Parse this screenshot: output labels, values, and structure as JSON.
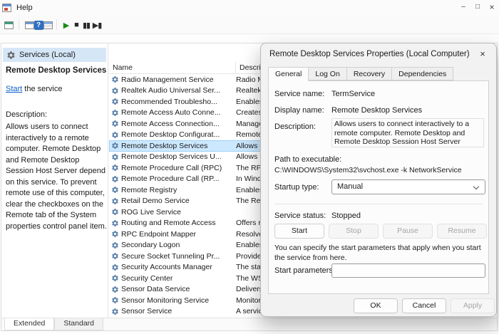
{
  "window": {
    "menu_help": "Help",
    "controls": {
      "minimize": "–",
      "maximize": "□",
      "close": "×"
    }
  },
  "toolbar": {
    "help_glyph": "?",
    "play_glyph": "▶",
    "stop_glyph": "■",
    "pause_glyph": "▮▮",
    "restart_glyph": "▶▮"
  },
  "tree": {
    "root_label": "Services (Local)"
  },
  "left_panel": {
    "title": "Remote Desktop Services",
    "action_link": "Start",
    "action_suffix": " the service",
    "description_heading": "Description:",
    "description": "Allows users to connect interactively to a remote computer. Remote Desktop and Remote Desktop Session Host Server depend on this service. To prevent remote use of this computer, clear the checkboxes on the Remote tab of the System properties control panel item."
  },
  "services_list": {
    "columns": [
      "Name",
      "Description"
    ],
    "selected_index": 6,
    "rows": [
      {
        "name": "Radio Management Service",
        "desc": "Radio M..."
      },
      {
        "name": "Realtek Audio Universal Ser...",
        "desc": "Realtek ..."
      },
      {
        "name": "Recommended Troublesho...",
        "desc": "Enables..."
      },
      {
        "name": "Remote Access Auto Conne...",
        "desc": "Creates ..."
      },
      {
        "name": "Remote Access Connection...",
        "desc": "Manage..."
      },
      {
        "name": "Remote Desktop Configurat...",
        "desc": "Remote ..."
      },
      {
        "name": "Remote Desktop Services",
        "desc": "Allows u..."
      },
      {
        "name": "Remote Desktop Services U...",
        "desc": "Allows u..."
      },
      {
        "name": "Remote Procedure Call (RPC)",
        "desc": "The RPC..."
      },
      {
        "name": "Remote Procedure Call (RP...",
        "desc": "In Wind..."
      },
      {
        "name": "Remote Registry",
        "desc": "Enables..."
      },
      {
        "name": "Retail Demo Service",
        "desc": "The Reta..."
      },
      {
        "name": "ROG Live Service",
        "desc": ""
      },
      {
        "name": "Routing and Remote Access",
        "desc": "Offers ro..."
      },
      {
        "name": "RPC Endpoint Mapper",
        "desc": "Resolves..."
      },
      {
        "name": "Secondary Logon",
        "desc": "Enables..."
      },
      {
        "name": "Secure Socket Tunneling Pr...",
        "desc": "Provides..."
      },
      {
        "name": "Security Accounts Manager",
        "desc": "The start..."
      },
      {
        "name": "Security Center",
        "desc": "The WSC..."
      },
      {
        "name": "Sensor Data Service",
        "desc": "Delivers ..."
      },
      {
        "name": "Sensor Monitoring Service",
        "desc": "Monitor..."
      },
      {
        "name": "Sensor Service",
        "desc": "A service..."
      }
    ]
  },
  "view_tabs": {
    "extended": "Extended",
    "standard": "Standard"
  },
  "dialog": {
    "title": "Remote Desktop Services Properties (Local Computer)",
    "close_glyph": "×",
    "tabs": [
      "General",
      "Log On",
      "Recovery",
      "Dependencies"
    ],
    "general": {
      "service_name_label": "Service name:",
      "service_name": "TermService",
      "display_name_label": "Display name:",
      "display_name": "Remote Desktop Services",
      "description_label": "Description:",
      "description": "Allows users to connect interactively to a remote computer. Remote Desktop and Remote Desktop Session Host Server depend on this service.  To",
      "path_label": "Path to executable:",
      "path": "C:\\WINDOWS\\System32\\svchost.exe -k NetworkService",
      "startup_type_label": "Startup type:",
      "startup_type": "Manual",
      "service_status_label": "Service status:",
      "service_status": "Stopped",
      "buttons": {
        "start": "Start",
        "stop": "Stop",
        "pause": "Pause",
        "resume": "Resume"
      },
      "hint": "You can specify the start parameters that apply when you start the service from here.",
      "start_parameters_label": "Start parameters:"
    },
    "footer": {
      "ok": "OK",
      "cancel": "Cancel",
      "apply": "Apply"
    }
  }
}
